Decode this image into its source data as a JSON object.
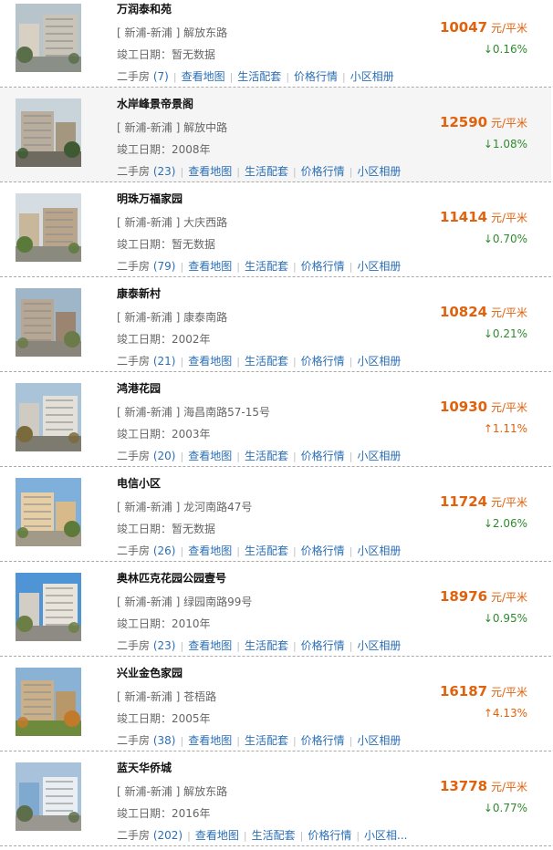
{
  "labels": {
    "completion_prefix": "竣工日期：",
    "second_hand": "二手房",
    "view_map": "查看地图",
    "amenities": "生活配套",
    "price_trend": "价格行情",
    "album": "小区相册",
    "price_unit": "元/平米"
  },
  "colors": {
    "price": "#e0620d",
    "down": "#2f8a2f",
    "up": "#e0620d",
    "link": "#2a6fb5"
  },
  "listings": [
    {
      "name": "万润泰和苑",
      "district": "[ 新浦-新浦 ]",
      "street": "解放东路",
      "completion": "暂无数据",
      "count": "(7)",
      "price": "10047",
      "change": "↓0.16%",
      "direction": "down",
      "album": "小区相册"
    },
    {
      "name": "水岸峰景帝景阁",
      "district": "[ 新浦-新浦 ]",
      "street": "解放中路",
      "completion": "2008年",
      "count": "(23)",
      "price": "12590",
      "change": "↓1.08%",
      "direction": "down",
      "album": "小区相册"
    },
    {
      "name": "明珠万福家园",
      "district": "[ 新浦-新浦 ]",
      "street": "大庆西路",
      "completion": "暂无数据",
      "count": "(79)",
      "price": "11414",
      "change": "↓0.70%",
      "direction": "down",
      "album": "小区相册"
    },
    {
      "name": "康泰新村",
      "district": "[ 新浦-新浦 ]",
      "street": "康泰南路",
      "completion": "2002年",
      "count": "(21)",
      "price": "10824",
      "change": "↓0.21%",
      "direction": "down",
      "album": "小区相册"
    },
    {
      "name": "鸿港花园",
      "district": "[ 新浦-新浦 ]",
      "street": "海昌南路57-15号",
      "completion": "2003年",
      "count": "(20)",
      "price": "10930",
      "change": "↑1.11%",
      "direction": "up",
      "album": "小区相册"
    },
    {
      "name": "电信小区",
      "district": "[ 新浦-新浦 ]",
      "street": "龙河南路47号",
      "completion": "暂无数据",
      "count": "(26)",
      "price": "11724",
      "change": "↓2.06%",
      "direction": "down",
      "album": "小区相册"
    },
    {
      "name": "奥林匹克花园公园壹号",
      "district": "[ 新浦-新浦 ]",
      "street": "绿园南路99号",
      "completion": "2010年",
      "count": "(23)",
      "price": "18976",
      "change": "↓0.95%",
      "direction": "down",
      "album": "小区相册"
    },
    {
      "name": "兴业金色家园",
      "district": "[ 新浦-新浦 ]",
      "street": "苍梧路",
      "completion": "2005年",
      "count": "(38)",
      "price": "16187",
      "change": "↑4.13%",
      "direction": "up",
      "album": "小区相册"
    },
    {
      "name": "蓝天华侨城",
      "district": "[ 新浦-新浦 ]",
      "street": "解放东路",
      "completion": "2016年",
      "count": "(202)",
      "price": "13778",
      "change": "↓0.77%",
      "direction": "down",
      "album": "小区相..."
    }
  ]
}
